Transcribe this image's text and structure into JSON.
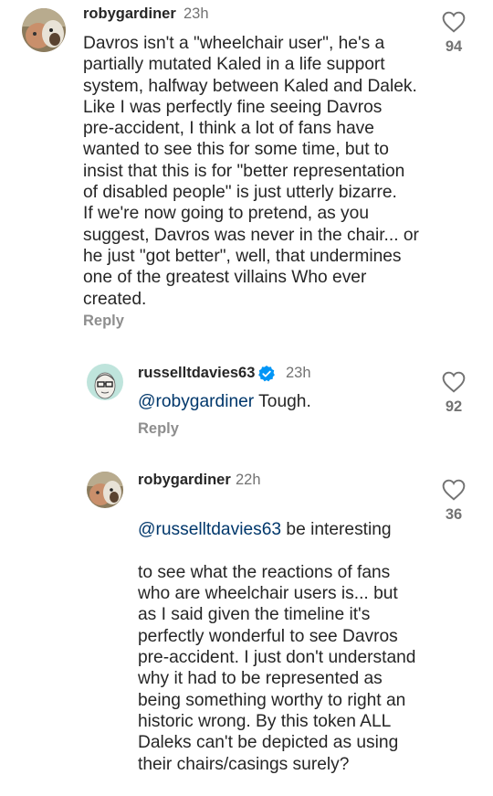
{
  "comments": [
    {
      "username": "robygardiner",
      "time": "23h",
      "text": "Davros isn't a \"wheelchair user\", he's a\npartially mutated Kaled in a life support\nsystem, halfway between Kaled and Dalek.\nLike I was perfectly fine seeing Davros\npre-accident, I think a lot of fans have\nwanted to see this for some time, but to\ninsist that this is for \"better representation\nof disabled people\" is just utterly bizarre.\nIf we're now going to pretend, as you\nsuggest, Davros was never in the chair... or\nhe just \"got better\", well, that undermines\none of the greatest villains Who ever\ncreated.",
      "reply_label": "Reply",
      "likes": "94"
    },
    {
      "username": "russelltdavies63",
      "time": "23h",
      "mention": "@robygardiner",
      "text": " Tough.",
      "reply_label": "Reply",
      "likes": "92"
    },
    {
      "username": "robygardiner",
      "time": "22h",
      "mention": "@russelltdavies63",
      "text_first": " be interesting",
      "text_rest": "to see what the reactions of fans\nwho are wheelchair users is... but\nas I said given the timeline it's\nperfectly wonderful to see Davros\npre-accident. I just don't understand\nwhy it had to be represented as\nbeing something worthy to right an\nhistoric wrong. By this token ALL\nDaleks can't be depicted as using\ntheir chairs/casings surely?",
      "likes": "36"
    }
  ],
  "icons": {
    "like": "heart-outline-icon",
    "verified": "verified-badge-icon"
  },
  "colors": {
    "mention": "#00376b",
    "verified": "#0095f6",
    "muted": "#737373"
  }
}
